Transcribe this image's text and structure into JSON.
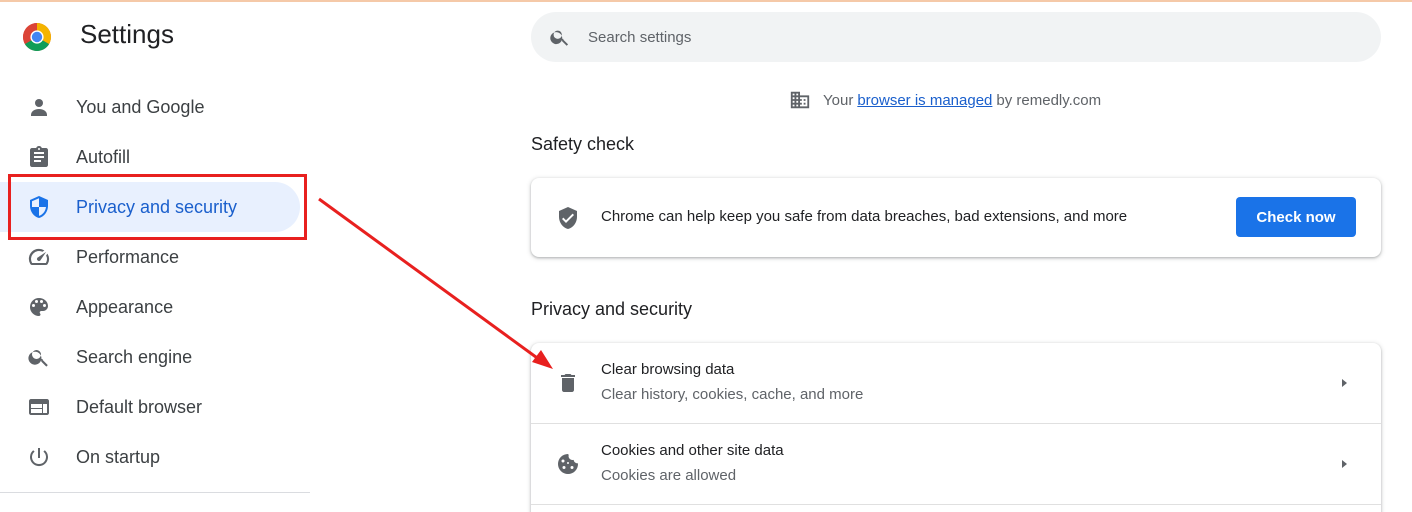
{
  "app": {
    "title": "Settings",
    "logo_icon": "chrome-logo-icon"
  },
  "sidebar": {
    "items": [
      {
        "label": "You and Google",
        "icon": "person-icon"
      },
      {
        "label": "Autofill",
        "icon": "clipboard-icon"
      },
      {
        "label": "Privacy and security",
        "icon": "shield-icon",
        "active": true
      },
      {
        "label": "Performance",
        "icon": "speedometer-icon"
      },
      {
        "label": "Appearance",
        "icon": "palette-icon"
      },
      {
        "label": "Search engine",
        "icon": "search-icon"
      },
      {
        "label": "Default browser",
        "icon": "browser-window-icon"
      },
      {
        "label": "On startup",
        "icon": "power-icon"
      }
    ]
  },
  "search": {
    "placeholder": "Search settings",
    "value": ""
  },
  "managed_notice": {
    "prefix": "Your",
    "link": "browser is managed",
    "suffix": "by remedly.com",
    "icon": "building-icon"
  },
  "safety_check": {
    "heading": "Safety check",
    "description": "Chrome can help keep you safe from data breaches, bad extensions, and more",
    "button_label": "Check now",
    "icon": "shield-check-icon"
  },
  "privacy": {
    "heading": "Privacy and security",
    "rows": [
      {
        "title": "Clear browsing data",
        "subtitle": "Clear history, cookies, cache, and more",
        "icon": "trash-icon"
      },
      {
        "title": "Cookies and other site data",
        "subtitle": "Cookies are allowed",
        "icon": "cookie-icon"
      }
    ]
  },
  "colors": {
    "accent": "#1a73e8",
    "active_bg": "#e8f0fe",
    "annotation_red": "#e8201f"
  }
}
